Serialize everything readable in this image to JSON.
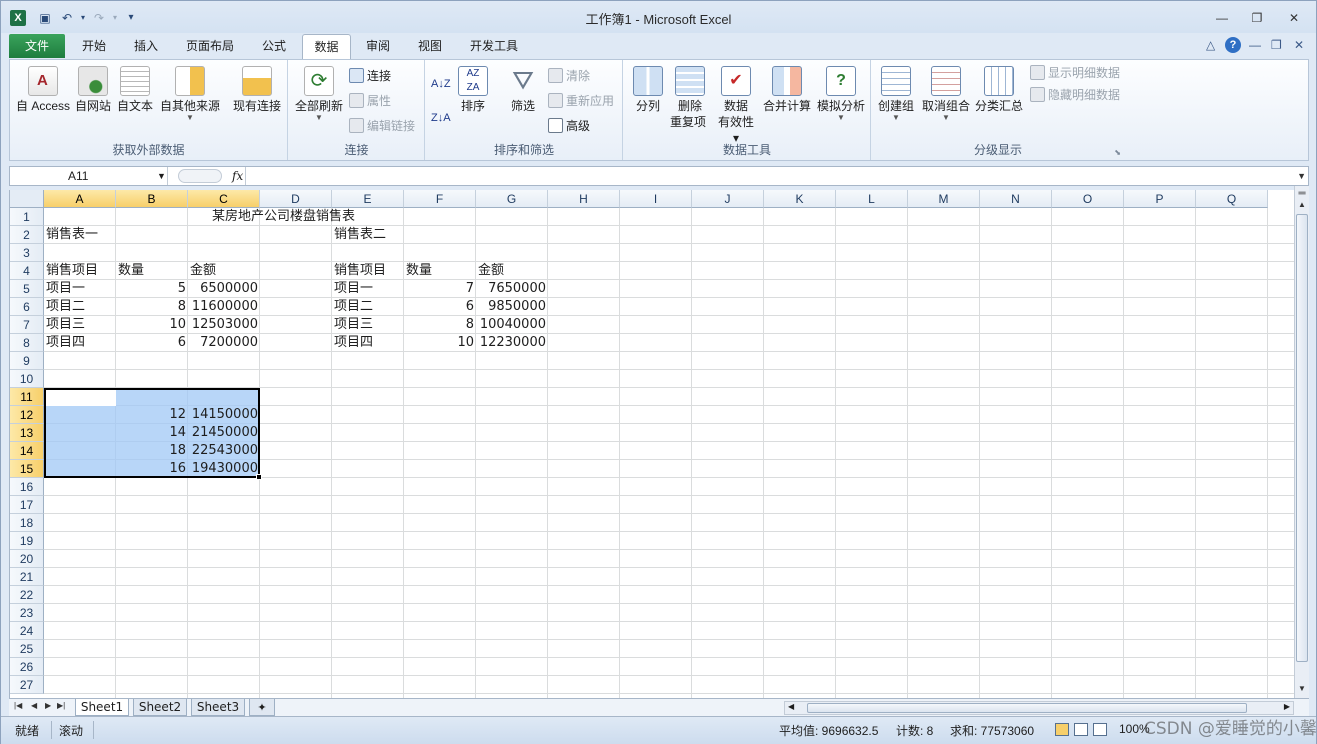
{
  "window": {
    "title": "工作簿1 - Microsoft Excel",
    "app_icon": "X",
    "controls": [
      "minimize-icon",
      "restore-icon",
      "close-icon"
    ]
  },
  "quick_access": {
    "icons": [
      "save-icon",
      "undo-icon",
      "redo-icon",
      "customize-icon"
    ]
  },
  "tabs": {
    "file": "文件",
    "items": [
      "开始",
      "插入",
      "页面布局",
      "公式",
      "数据",
      "审阅",
      "视图",
      "开发工具"
    ],
    "active": "数据"
  },
  "ribbon": {
    "get_external": {
      "label": "获取外部数据",
      "access": "自 Access",
      "web": "自网站",
      "text": "自文本",
      "other": "自其他来源",
      "existing": "现有连接"
    },
    "connections": {
      "label": "连接",
      "refresh": "全部刷新",
      "connections": "连接",
      "properties": "属性",
      "edit_links": "编辑链接"
    },
    "sort_filter": {
      "label": "排序和筛选",
      "sort_az": "A↓Z",
      "sort_za": "Z↓A",
      "sort": "排序",
      "filter": "筛选",
      "clear": "清除",
      "reapply": "重新应用",
      "advanced": "高级"
    },
    "data_tools": {
      "label": "数据工具",
      "text_to_columns": "分列",
      "remove_dup_1": "删除",
      "remove_dup_2": "重复项",
      "validation_1": "数据",
      "validation_2": "有效性",
      "consolidate": "合并计算",
      "whatif": "模拟分析"
    },
    "outline": {
      "label": "分级显示",
      "group": "创建组",
      "ungroup": "取消组合",
      "subtotal": "分类汇总",
      "show_detail": "显示明细数据",
      "hide_detail": "隐藏明细数据"
    }
  },
  "formula_bar": {
    "name_box": "A11",
    "fx": "fx",
    "formula": ""
  },
  "columns": [
    "A",
    "B",
    "C",
    "D",
    "E",
    "F",
    "G",
    "H",
    "I",
    "J",
    "K",
    "L",
    "M",
    "N",
    "O",
    "P",
    "Q"
  ],
  "rows": [
    "1",
    "2",
    "3",
    "4",
    "5",
    "6",
    "7",
    "8",
    "9",
    "10",
    "11",
    "12",
    "13",
    "14",
    "15",
    "16",
    "17",
    "18",
    "19",
    "20",
    "21",
    "22",
    "23",
    "24",
    "25",
    "26",
    "27"
  ],
  "selection": {
    "columns": [
      "A",
      "B",
      "C"
    ],
    "rows": [
      "11",
      "12",
      "13",
      "14",
      "15"
    ],
    "active_cell": "A11"
  },
  "cells": {
    "title": "某房地产公司楼盘销售表",
    "table1_name": "销售表一",
    "table2_name": "销售表二",
    "header_item": "销售项目",
    "header_qty": "数量",
    "header_amount": "金额",
    "table1": [
      {
        "item": "项目一",
        "qty": "5",
        "amount": "6500000"
      },
      {
        "item": "项目二",
        "qty": "8",
        "amount": "11600000"
      },
      {
        "item": "项目三",
        "qty": "10",
        "amount": "12503000"
      },
      {
        "item": "项目四",
        "qty": "6",
        "amount": "7200000"
      }
    ],
    "table2": [
      {
        "item": "项目一",
        "qty": "7",
        "amount": "7650000"
      },
      {
        "item": "项目二",
        "qty": "6",
        "amount": "9850000"
      },
      {
        "item": "项目三",
        "qty": "8",
        "amount": "10040000"
      },
      {
        "item": "项目四",
        "qty": "10",
        "amount": "12230000"
      }
    ],
    "sums": [
      {
        "qty": "12",
        "amount": "14150000"
      },
      {
        "qty": "14",
        "amount": "21450000"
      },
      {
        "qty": "18",
        "amount": "22543000"
      },
      {
        "qty": "16",
        "amount": "19430000"
      }
    ]
  },
  "sheets": {
    "items": [
      "Sheet1",
      "Sheet2",
      "Sheet3"
    ],
    "active": "Sheet1"
  },
  "status": {
    "ready": "就绪",
    "scroll": "滚动",
    "average": "平均值: 9696632.5",
    "count": "计数: 8",
    "sum": "求和: 77573060",
    "zoom": "100%"
  },
  "watermark": "CSDN @爱睡觉的小馨"
}
